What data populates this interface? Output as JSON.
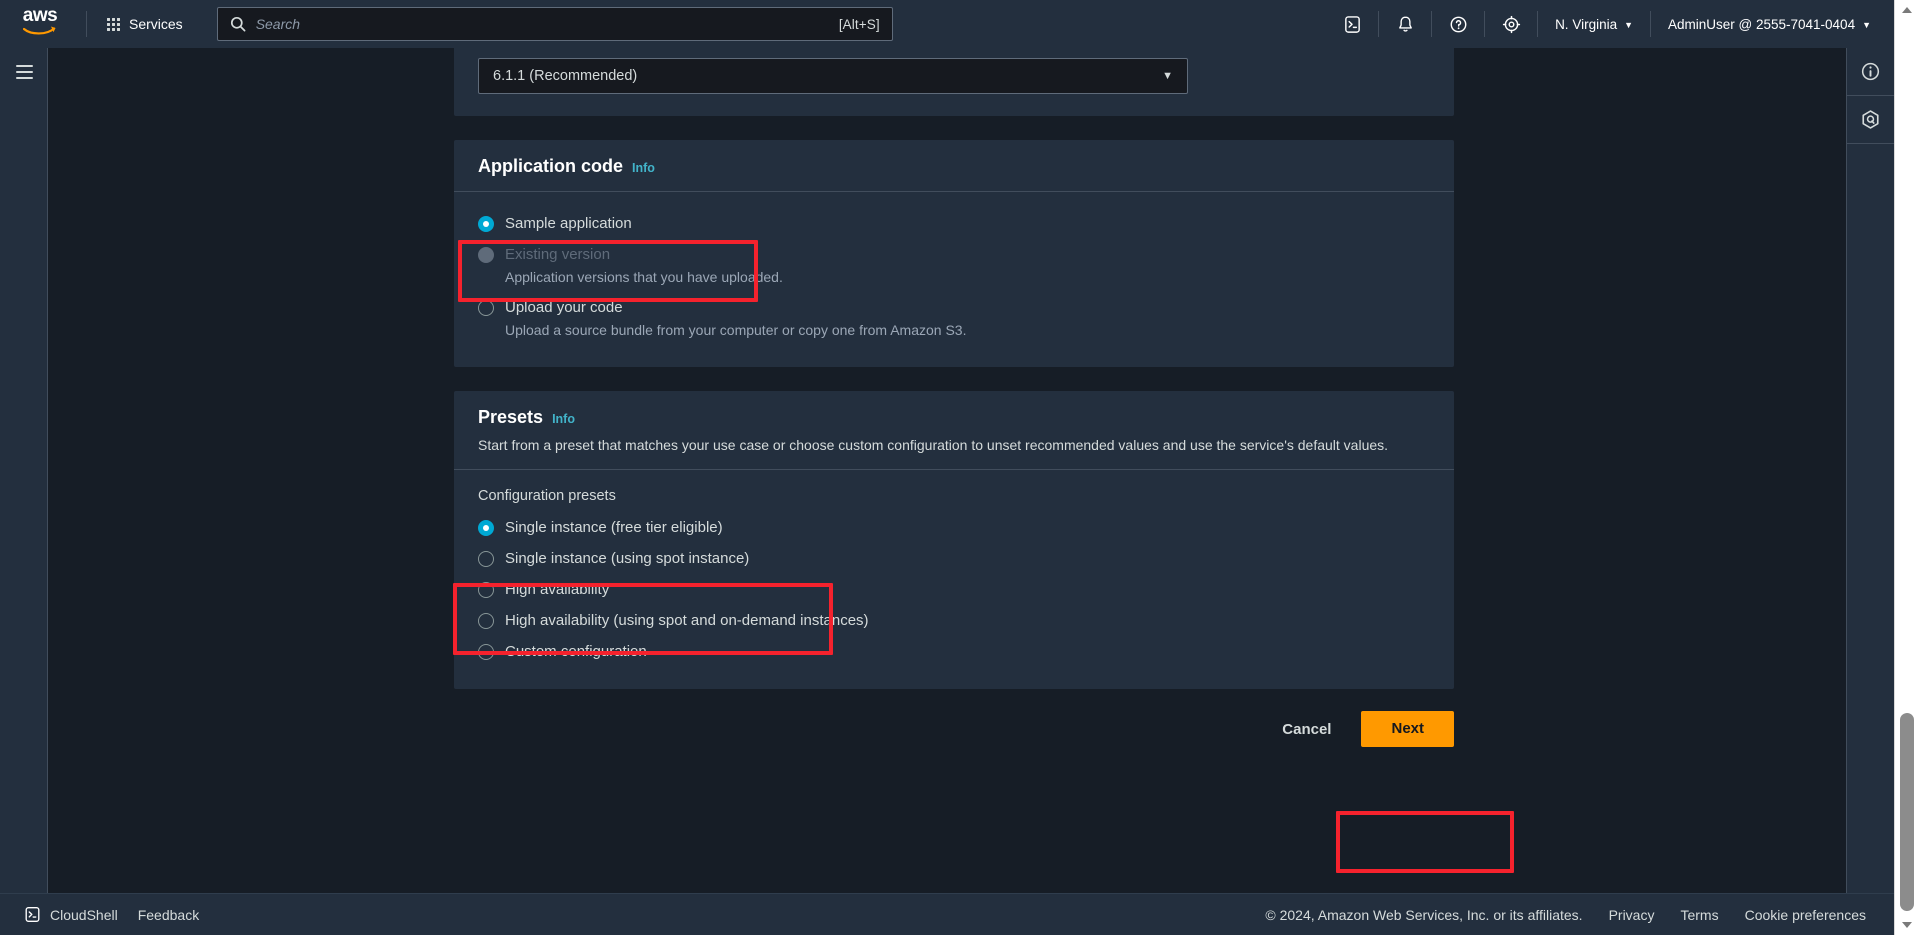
{
  "topnav": {
    "logo_text": "aws",
    "services_label": "Services",
    "search": {
      "placeholder": "Search",
      "value": "",
      "shortcut": "[Alt+S]"
    },
    "icons": [
      {
        "name": "cloudshell-icon",
        "title": "CloudShell"
      },
      {
        "name": "notifications-bell-icon",
        "title": "Notifications"
      },
      {
        "name": "help-question-icon",
        "title": "Help"
      },
      {
        "name": "settings-gear-icon",
        "title": "Settings"
      }
    ],
    "region": "N. Virginia",
    "account": "AdminUser @ 2555-7041-0404"
  },
  "left_rail": {
    "menu_icon": "hamburger-menu-icon"
  },
  "right_rail": {
    "items": [
      {
        "name": "info-panel-icon"
      },
      {
        "name": "amazon-q-icon"
      }
    ]
  },
  "platform_version": {
    "selected": "6.1.1 (Recommended)",
    "arrow": "▼"
  },
  "application_code": {
    "title": "Application code",
    "info_label": "Info",
    "options": [
      {
        "label": "Sample application",
        "desc": "",
        "selected": true,
        "disabled": false
      },
      {
        "label": "Existing version",
        "desc": "Application versions that you have uploaded.",
        "selected": false,
        "disabled": true
      },
      {
        "label": "Upload your code",
        "desc": "Upload a source bundle from your computer or copy one from Amazon S3.",
        "selected": false,
        "disabled": false
      }
    ]
  },
  "presets": {
    "title": "Presets",
    "info_label": "Info",
    "description": "Start from a preset that matches your use case or choose custom configuration to unset recommended values and use the service's default values.",
    "group_label": "Configuration presets",
    "options": [
      {
        "label": "Single instance (free tier eligible)",
        "selected": true
      },
      {
        "label": "Single instance (using spot instance)",
        "selected": false
      },
      {
        "label": "High availability",
        "selected": false
      },
      {
        "label": "High availability (using spot and on-demand instances)",
        "selected": false
      },
      {
        "label": "Custom configuration",
        "selected": false
      }
    ]
  },
  "actions": {
    "cancel_label": "Cancel",
    "next_label": "Next"
  },
  "bottombar": {
    "cloudshell_label": "CloudShell",
    "feedback_label": "Feedback",
    "copyright": "© 2024, Amazon Web Services, Inc. or its affiliates.",
    "links": [
      "Privacy",
      "Terms",
      "Cookie preferences"
    ]
  },
  "colors": {
    "accent_orange": "#ff9900",
    "radio_selected": "#00a9d4",
    "info_link": "#42b4ca",
    "highlight_red": "#f5222d",
    "nav_bg": "#232f3e",
    "content_bg": "#161d26"
  }
}
